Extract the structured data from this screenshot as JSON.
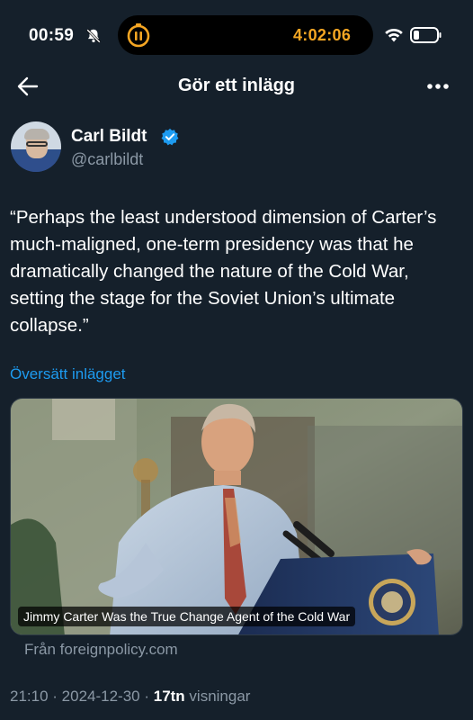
{
  "status_bar": {
    "time": "00:59",
    "island_time": "4:02:06",
    "icons": [
      "bell-slash-icon",
      "pause-timer-icon",
      "wifi-icon",
      "battery-icon"
    ],
    "accent_color": "#f5a623"
  },
  "nav": {
    "title": "Gör ett inlägg",
    "back_icon": "arrow-left-icon",
    "more_icon": "more-dots-icon"
  },
  "author": {
    "name": "Carl Bildt",
    "handle": "@carlbildt",
    "verified": true,
    "verified_color": "#1d9bf0"
  },
  "tweet": {
    "text": "“Perhaps the least understood dimension of Carter’s much-maligned, one-term presidency was that he dramatically changed the nature of the Cold War, setting the stage for the Soviet Union’s ultimate collapse.”",
    "translate_label": "Översätt inlägget"
  },
  "link_card": {
    "caption": "Jimmy Carter Was the True Change Agent of the Cold War",
    "source": "Från foreignpolicy.com"
  },
  "meta": {
    "time": "21:10",
    "separator": " · ",
    "date": "2024-12-30",
    "views": "17tn",
    "views_label": " visningar"
  },
  "colors": {
    "background": "#15202b",
    "link": "#1d9bf0",
    "secondary_text": "#8b98a5"
  }
}
